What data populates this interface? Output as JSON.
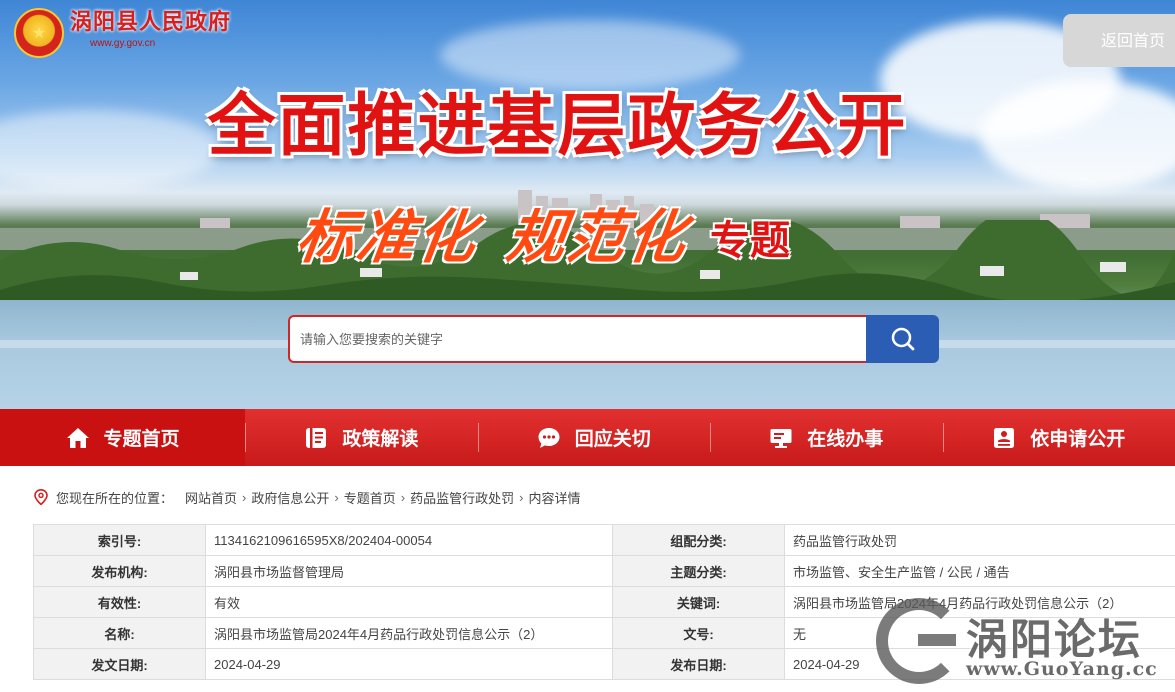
{
  "site": {
    "name": "涡阳县人民政府",
    "domain": "www.gy.gov.cn",
    "home_return": "返回首页"
  },
  "banner": {
    "title": "全面推进基层政务公开",
    "subtitle_part1": "标准化",
    "subtitle_part2": "规范化",
    "subtitle_label": "专题"
  },
  "search": {
    "placeholder": "请输入您要搜索的关键字",
    "button_icon": "search-icon"
  },
  "nav": {
    "items": [
      {
        "label": "专题首页",
        "icon": "home-icon",
        "active": true
      },
      {
        "label": "政策解读",
        "icon": "document-icon",
        "active": false
      },
      {
        "label": "回应关切",
        "icon": "chat-icon",
        "active": false
      },
      {
        "label": "在线办事",
        "icon": "computer-icon",
        "active": false
      },
      {
        "label": "依申请公开",
        "icon": "id-card-icon",
        "active": false
      }
    ]
  },
  "breadcrumb": {
    "lead": "您现在所在的位置：",
    "items": [
      "网站首页",
      "政府信息公开",
      "专题首页",
      "药品监管行政处罚",
      "内容详情"
    ],
    "separator": "›"
  },
  "info": {
    "rows": [
      {
        "k1": "索引号:",
        "v1": "11341621096165​95X8/202404-00054",
        "k2": "组配分类:",
        "v2": "药品监管行政处罚"
      },
      {
        "k1": "发布机构:",
        "v1": "涡阳县市场监督管理局",
        "k2": "主题分类:",
        "v2": "市场监管、安全生产监管 / 公民 / 通告"
      },
      {
        "k1": "有效性:",
        "v1": "有效",
        "k2": "关键词:",
        "v2": "涡阳县市场监管局2024年4月药品行政处罚信息公示（2）"
      },
      {
        "k1": "名称:",
        "v1": "涡阳县市场监管局2024年4月药品行政处罚信息公示（2）",
        "k2": "文号:",
        "v2": "无"
      },
      {
        "k1": "发文日期:",
        "v1": "2024-04-29",
        "k2": "发布日期:",
        "v2": "2024-04-29"
      }
    ]
  },
  "watermark": {
    "text": "涡阳论坛",
    "url": "www.GuoYang.cc"
  },
  "colors": {
    "nav_red": "#d42020",
    "title_red": "#e01212",
    "search_blue": "#2b5db5"
  }
}
